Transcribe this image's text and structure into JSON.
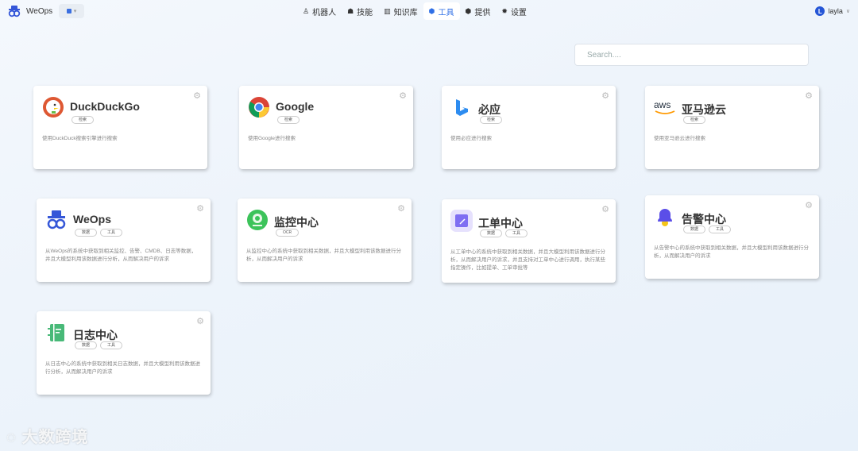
{
  "app": {
    "title": "WeOps"
  },
  "nav": {
    "items": [
      {
        "label": "机器人",
        "icon": "robot-icon"
      },
      {
        "label": "技能",
        "icon": "skill-icon"
      },
      {
        "label": "知识库",
        "icon": "knowledge-icon"
      },
      {
        "label": "工具",
        "icon": "tool-icon",
        "active": true
      },
      {
        "label": "提供",
        "icon": "provider-icon"
      },
      {
        "label": "设置",
        "icon": "settings-icon"
      }
    ]
  },
  "user": {
    "initial": "L",
    "name": "layla"
  },
  "search": {
    "placeholder": "Search...."
  },
  "colors": {
    "accent": "#2f6fe6"
  },
  "cards": [
    {
      "name": "DuckDuckGo",
      "tags": [
        "检索"
      ],
      "desc": "使用DuckDuck搜索引擎进行搜索"
    },
    {
      "name": "Google",
      "tags": [
        "检索"
      ],
      "desc": "使用Google进行搜索"
    },
    {
      "name": "必应",
      "tags": [
        "检索"
      ],
      "desc": "使用必应进行搜索"
    },
    {
      "name": "亚马逊云",
      "tags": [
        "检索"
      ],
      "desc": "使用亚马逊云进行搜索"
    },
    {
      "name": "WeOps",
      "tags": [
        "数据",
        "工具"
      ],
      "desc": "从WeOps的系统中获取到相关监控、告警、CMDB、日志等数据，并且大模型利用该数据进行分析，从而解决用户的诉求"
    },
    {
      "name": "监控中心",
      "tags": [
        "OCR"
      ],
      "desc": "从监控中心的系统中获取到相关数据，并且大模型利用该数据进行分析，从而解决用户的诉求"
    },
    {
      "name": "工单中心",
      "tags": [
        "数据",
        "工具"
      ],
      "desc": "从工单中心的系统中获取到相关数据，并且大模型利用该数据进行分析，从而解决用户的诉求，并且支持对工单中心进行调用，执行某些指定操作，比如提单、工单审批等"
    },
    {
      "name": "告警中心",
      "tags": [
        "数据",
        "工具"
      ],
      "desc": "从告警中心的系统中获取到相关数据，并且大模型利用该数据进行分析，从而解决用户的诉求"
    },
    {
      "name": "日志中心",
      "tags": [
        "数据",
        "工具"
      ],
      "desc": "从日志中心的系统中获取到相关日志数据，并且大模型利用该数据进行分析，从而解决用户的诉求"
    }
  ],
  "watermark": "大数跨境"
}
